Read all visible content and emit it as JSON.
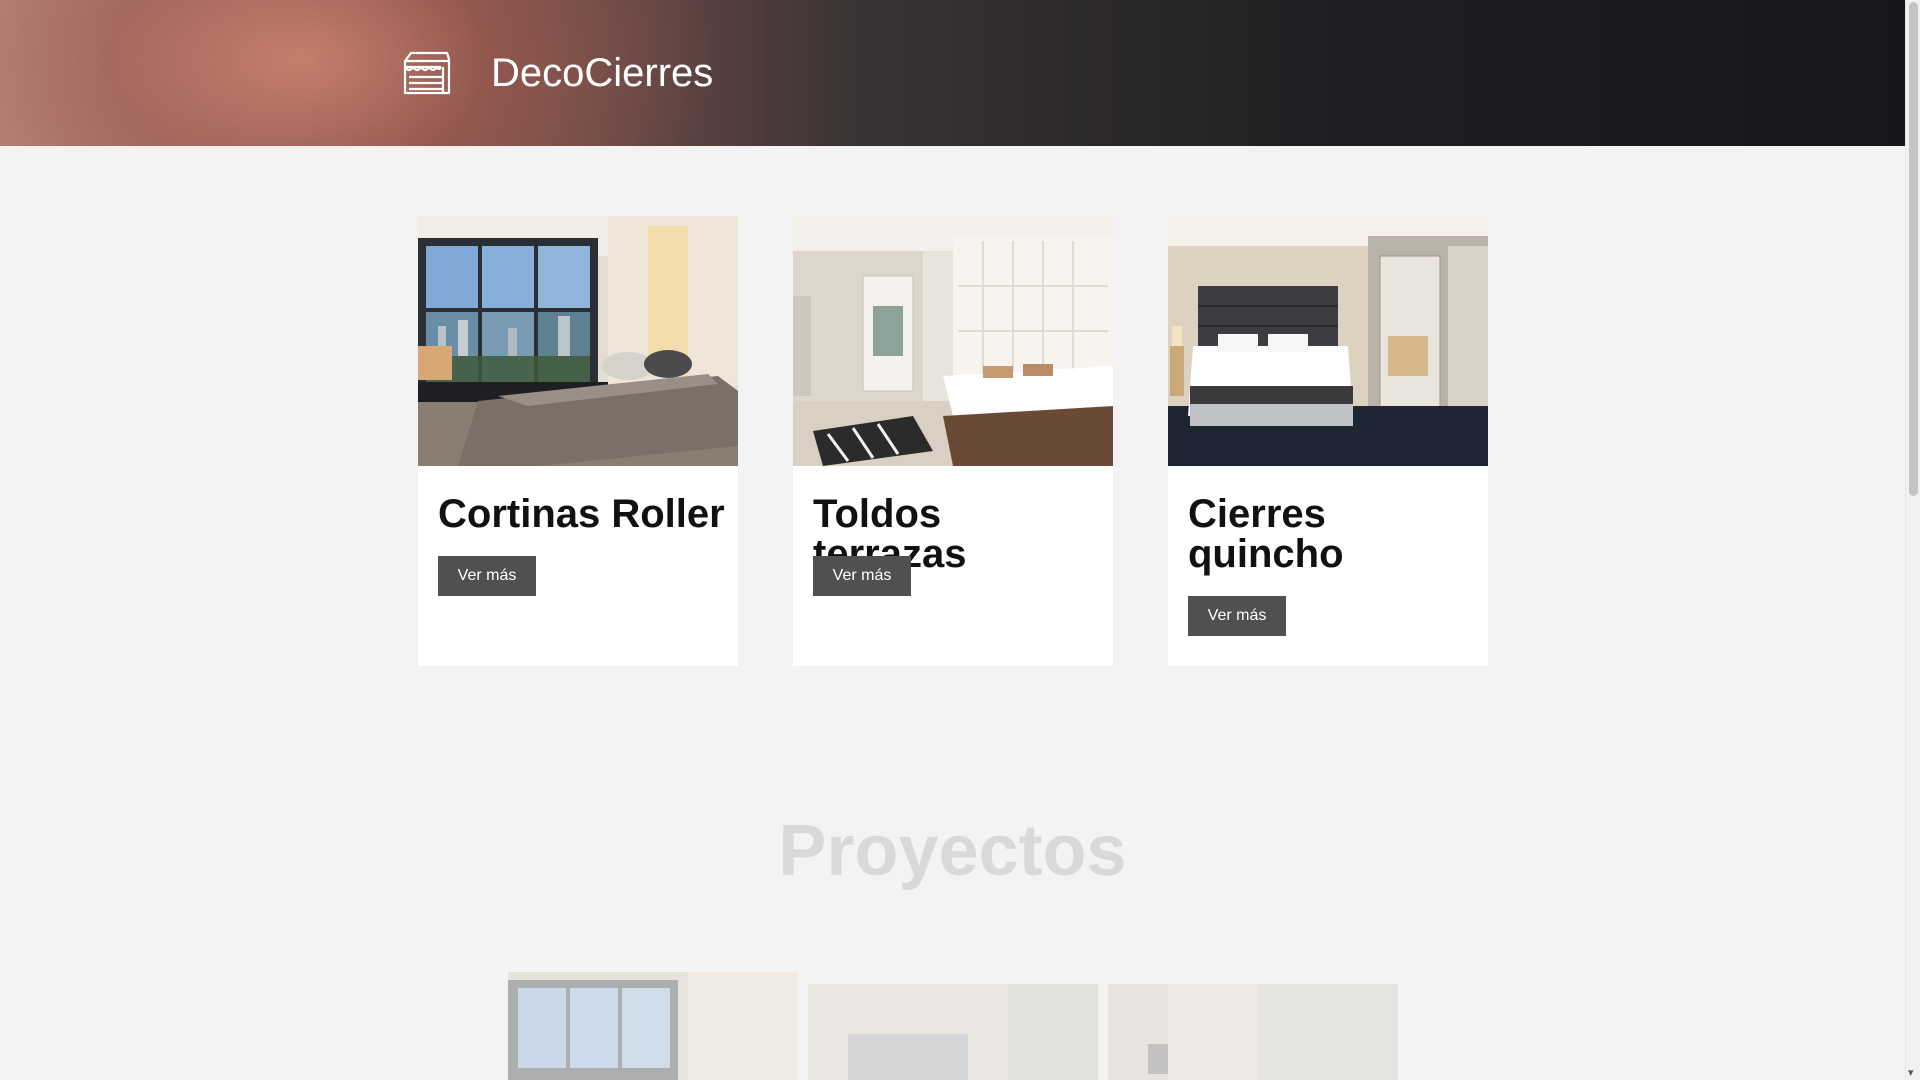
{
  "header": {
    "brand": "DecoCierres",
    "logo_icon": "storefront-icon",
    "colors": {
      "text": "#ffffff",
      "dark": "#15171a",
      "warm": "#b98a7e"
    }
  },
  "cards": [
    {
      "title": "Cortinas Roller",
      "button": "Ver más",
      "image": "bedroom-large-windows-city-view"
    },
    {
      "title": "Toldos terrazas",
      "button": "Ver más",
      "image": "bedroom-white-tufted-headboard"
    },
    {
      "title": "Cierres quincho",
      "button": "Ver más",
      "image": "hotel-bedroom-sliding-mirror-door"
    }
  ],
  "projects": {
    "title": "Proyectos"
  },
  "colors": {
    "page_bg": "#f3f3f3",
    "card_bg": "#ffffff",
    "button_bg": "#505050",
    "section_title": "#d9d9d9"
  }
}
